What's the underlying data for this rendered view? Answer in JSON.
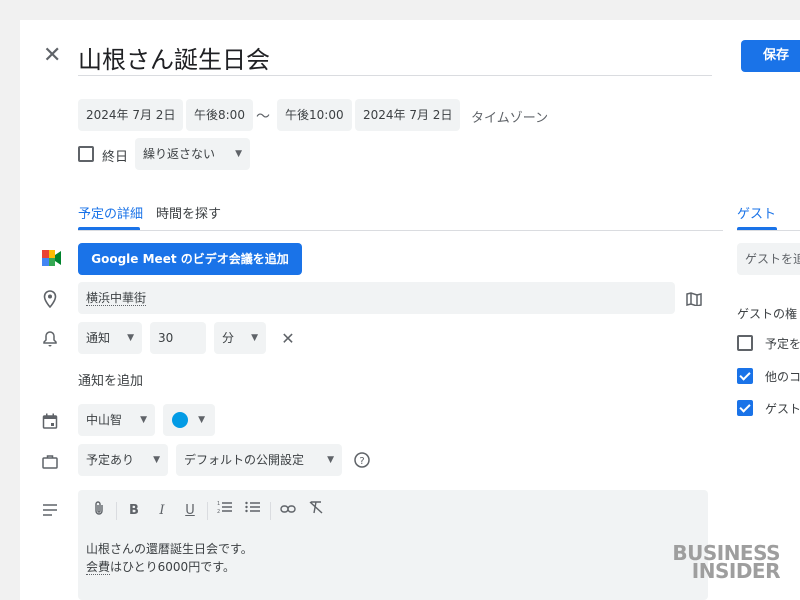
{
  "event": {
    "title": "山根さん誕生日会",
    "save_label": "保存",
    "start_date": "2024年 7月 2日",
    "start_time": "午後8:00",
    "separator": "〜",
    "end_time": "午後10:00",
    "end_date": "2024年 7月 2日",
    "timezone_label": "タイムゾーン",
    "all_day_label": "終日",
    "all_day_checked": false,
    "repeat_label": "繰り返さない"
  },
  "tabs": {
    "details": "予定の詳細",
    "find_time": "時間を探す",
    "guests": "ゲスト"
  },
  "meet": {
    "button_label": "Google Meet のビデオ会議を追加"
  },
  "location": {
    "value": "横浜中華街"
  },
  "notification": {
    "type": "通知",
    "amount": "30",
    "unit": "分",
    "add_label": "通知を追加"
  },
  "calendar": {
    "owner": "中山智",
    "color": "#039be5"
  },
  "availability": {
    "status": "予定あり",
    "visibility": "デフォルトの公開設定"
  },
  "description": {
    "line1": "山根さんの還暦誕生日会です。",
    "line2_prefix": "会費",
    "line2_rest": "はひとり6000円です。"
  },
  "guests": {
    "input_placeholder": "ゲストを追",
    "permissions_title": "ゲストの権",
    "perm1": {
      "label": "予定を",
      "checked": false
    },
    "perm2": {
      "label": "他のコ",
      "checked": true
    },
    "perm3": {
      "label": "ゲスト",
      "checked": true
    }
  },
  "watermark": {
    "line1": "BUSINESS",
    "line2": "INSIDER"
  },
  "colors": {
    "accent": "#1a73e8",
    "calendar_dot": "#039be5"
  }
}
